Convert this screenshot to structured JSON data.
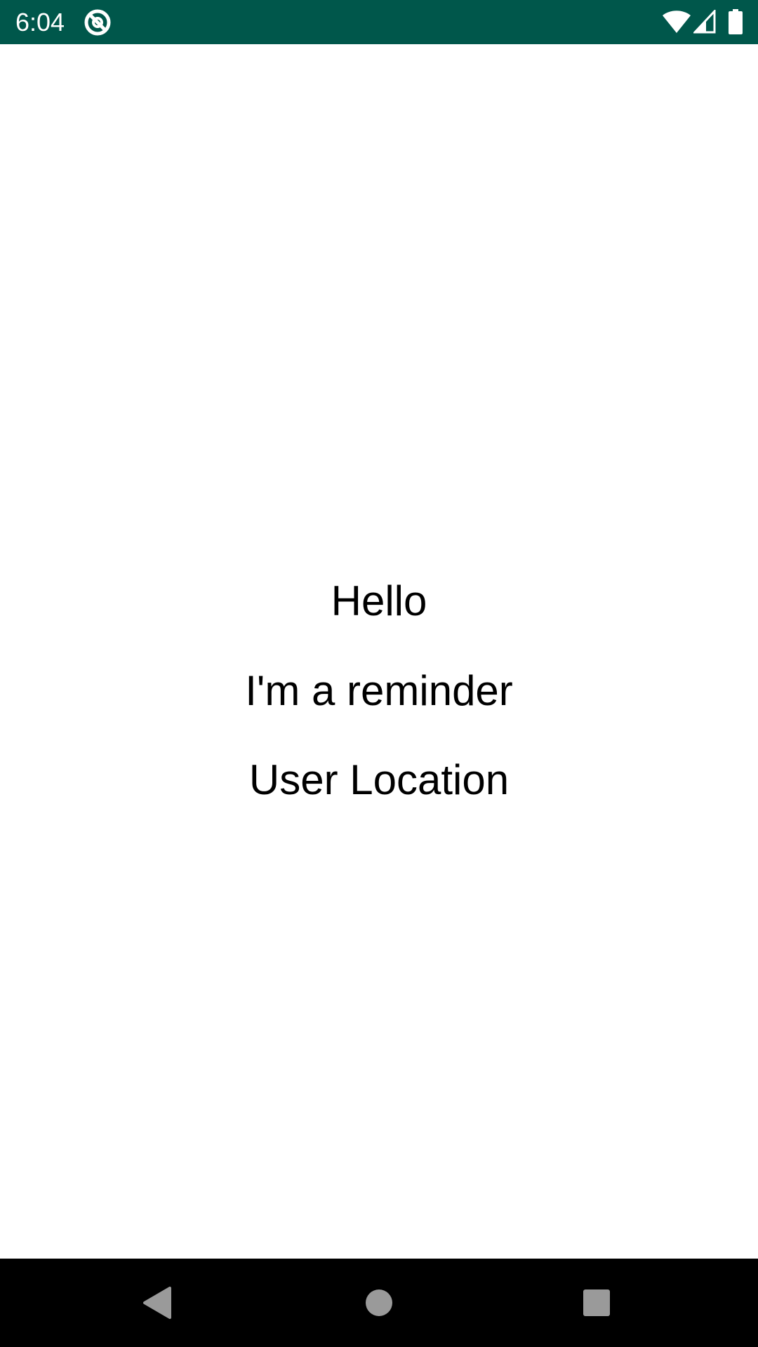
{
  "status_bar": {
    "time": "6:04",
    "background_color": "#00574b",
    "app_icon": "notification-app-icon",
    "wifi_icon": "wifi-icon",
    "signal_icon": "cell-signal-icon",
    "battery_icon": "battery-icon"
  },
  "main": {
    "lines": [
      "Hello",
      "I'm a reminder",
      "User Location"
    ]
  },
  "nav_bar": {
    "back_icon": "back-triangle-icon",
    "home_icon": "home-circle-icon",
    "recents_icon": "recents-square-icon"
  }
}
